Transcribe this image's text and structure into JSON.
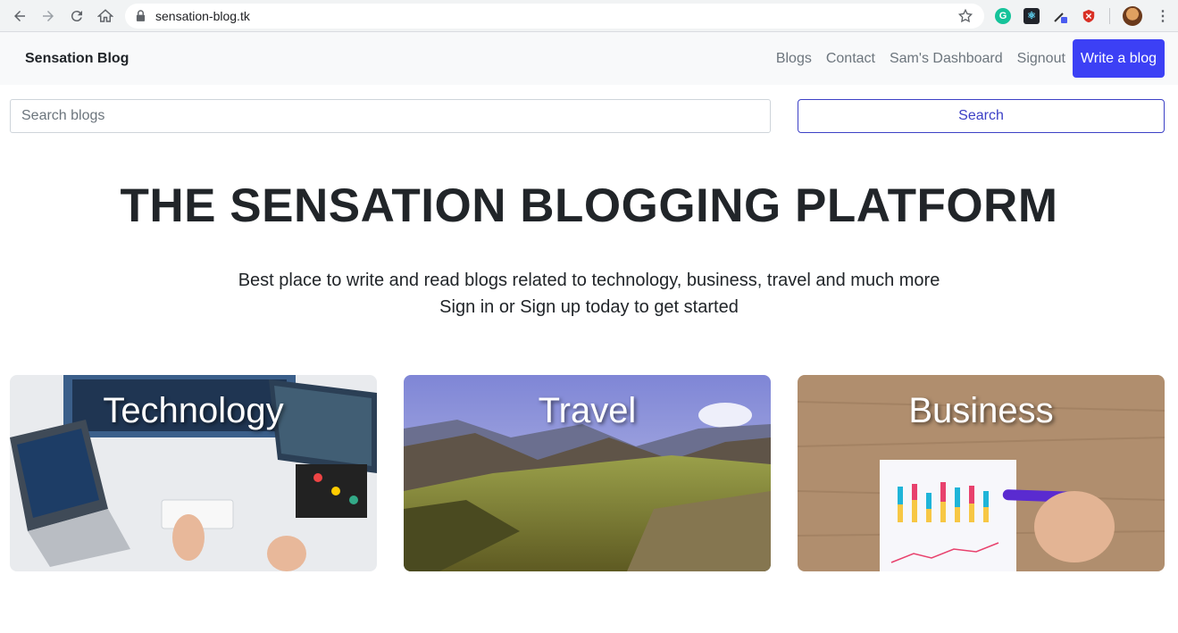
{
  "browser": {
    "url": "sensation-blog.tk",
    "extensions": [
      "grammarly-icon",
      "react-devtools-icon",
      "color-picker-icon",
      "shield-icon",
      "profile-avatar"
    ]
  },
  "navbar": {
    "brand": "Sensation Blog",
    "links": [
      "Blogs",
      "Contact",
      "Sam's Dashboard",
      "Signout"
    ],
    "write_button": "Write a blog",
    "accent_color": "#3c40f5"
  },
  "search": {
    "placeholder": "Search blogs",
    "button_label": "Search"
  },
  "hero": {
    "title": "THE SENSATION BLOGGING PLATFORM",
    "line1": "Best place to write and read blogs related to technology, business, travel and much more",
    "line2": "Sign in or Sign up today to get started"
  },
  "categories": [
    {
      "label": "Technology"
    },
    {
      "label": "Travel"
    },
    {
      "label": "Business"
    }
  ]
}
